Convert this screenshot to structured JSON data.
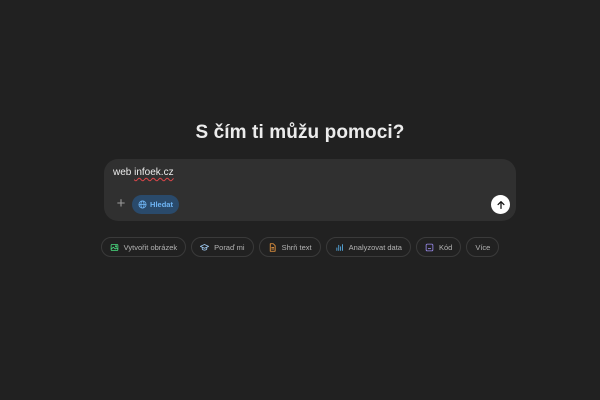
{
  "main": {
    "heading": "S čím ti můžu pomoci?"
  },
  "composer": {
    "input_value_prefix": "web ",
    "input_value_word": "infoek.cz",
    "search_label": "Hledat",
    "plus_glyph": "+"
  },
  "chips": [
    {
      "label": "Vytvořit obrázek",
      "icon": "image-icon",
      "color": "#4ade80"
    },
    {
      "label": "Poraď mi",
      "icon": "graduation-cap-icon",
      "color": "#9ec8f0"
    },
    {
      "label": "Shrň text",
      "icon": "document-icon",
      "color": "#f59e42"
    },
    {
      "label": "Analyzovat data",
      "icon": "bar-chart-icon",
      "color": "#5ab4f0"
    },
    {
      "label": "Kód",
      "icon": "code-icon",
      "color": "#9b8cf0"
    },
    {
      "label": "Více",
      "icon": "",
      "color": ""
    }
  ],
  "colors": {
    "background": "#212121",
    "composer": "#303030",
    "search_accent": "#6fb5f5",
    "search_bg": "#2a4a6b"
  }
}
